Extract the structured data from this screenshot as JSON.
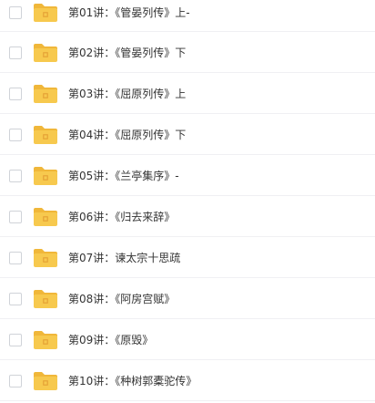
{
  "files": [
    {
      "name": "第01讲：《管晏列传》上-"
    },
    {
      "name": "第02讲：《管晏列传》下"
    },
    {
      "name": "第03讲：《屈原列传》上"
    },
    {
      "name": "第04讲：《屈原列传》下"
    },
    {
      "name": "第05讲：《兰亭集序》-"
    },
    {
      "name": "第06讲：《归去来辞》"
    },
    {
      "name": "第07讲：谏太宗十思疏"
    },
    {
      "name": "第08讲：《阿房宫赋》"
    },
    {
      "name": "第09讲：《原毁》"
    },
    {
      "name": "第10讲：《种树郭橐驼传》"
    }
  ],
  "icons": {
    "folder": "folder-icon",
    "checkbox": "checkbox"
  },
  "colors": {
    "folder_body": "#F7C94E",
    "folder_tab": "#F0B73A",
    "folder_clip": "#E8A93A",
    "text": "#333333",
    "divider": "#F0F0F3"
  }
}
